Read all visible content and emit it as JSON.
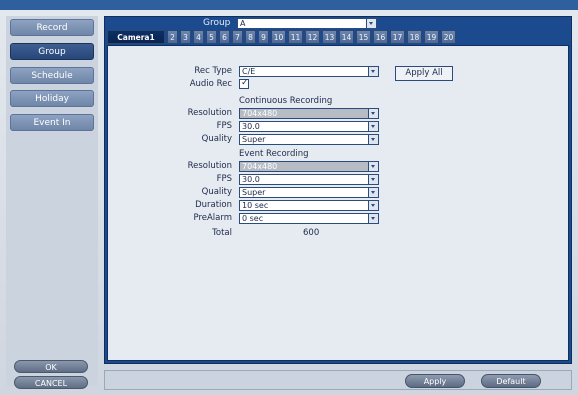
{
  "sidebar": {
    "items": [
      {
        "label": "Record",
        "active": false
      },
      {
        "label": "Group",
        "active": true
      },
      {
        "label": "Schedule",
        "active": false
      },
      {
        "label": "Holiday",
        "active": false
      },
      {
        "label": "Event In",
        "active": false
      }
    ],
    "ok_label": "OK",
    "cancel_label": "CANCEL"
  },
  "group": {
    "label": "Group",
    "value": "A"
  },
  "tabs": [
    "Camera1",
    "2",
    "3",
    "4",
    "5",
    "6",
    "7",
    "8",
    "9",
    "10",
    "11",
    "12",
    "13",
    "14",
    "15",
    "16",
    "17",
    "18",
    "19",
    "20"
  ],
  "form": {
    "rec_type": {
      "label": "Rec Type",
      "value": "C/E"
    },
    "audio_rec": {
      "label": "Audio Rec",
      "checked": true
    },
    "apply_all_label": "Apply All",
    "continuous": {
      "title": "Continuous Recording",
      "resolution": {
        "label": "Resolution",
        "value": "704x480"
      },
      "fps": {
        "label": "FPS",
        "value": "30.0"
      },
      "quality": {
        "label": "Quality",
        "value": "Super"
      }
    },
    "event": {
      "title": "Event Recording",
      "resolution": {
        "label": "Resolution",
        "value": "704x480"
      },
      "fps": {
        "label": "FPS",
        "value": "30.0"
      },
      "quality": {
        "label": "Quality",
        "value": "Super"
      },
      "duration": {
        "label": "Duration",
        "value": "10 sec"
      },
      "prealarm": {
        "label": "PreAlarm",
        "value": "0 sec"
      }
    },
    "total": {
      "label": "Total",
      "value": "600"
    }
  },
  "bottom": {
    "apply_label": "Apply",
    "default_label": "Default"
  }
}
